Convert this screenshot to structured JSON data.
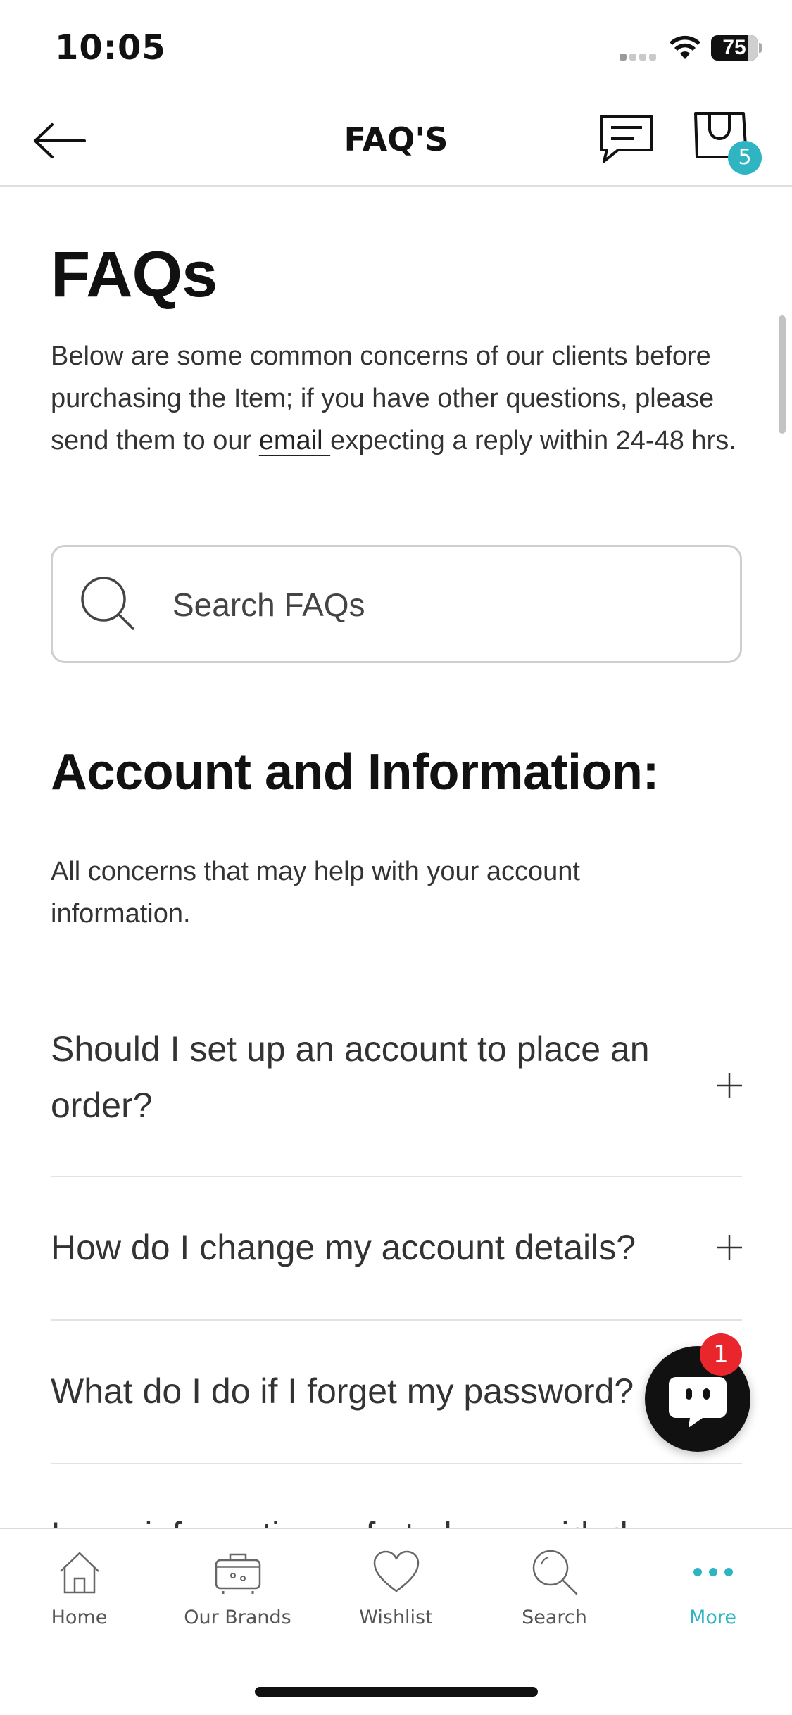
{
  "status_bar": {
    "time": "10:05",
    "battery": "75"
  },
  "nav": {
    "title": "FAQ'S",
    "cart_count": "5"
  },
  "page": {
    "title": "FAQs",
    "intro_before_link": "Below are some common concerns of our clients before purchasing the Item; if you have other questions, please send them to our ",
    "intro_link": "email ",
    "intro_after_link": "expecting a reply within 24-48 hrs."
  },
  "search": {
    "placeholder": "Search FAQs"
  },
  "section": {
    "title": "Account and Information:",
    "description": "All concerns that may help with your account information."
  },
  "faqs": [
    {
      "question": "Should I set up an account to place an order?"
    },
    {
      "question": "How do I change my account details?"
    },
    {
      "question": "What do I do if I forget my password?"
    },
    {
      "question": "Is my information safe to be provided"
    }
  ],
  "chat_widget": {
    "unread": "1"
  },
  "tabs": [
    {
      "label": "Home",
      "icon": "home-icon"
    },
    {
      "label": "Our Brands",
      "icon": "brands-icon"
    },
    {
      "label": "Wishlist",
      "icon": "heart-icon"
    },
    {
      "label": "Search",
      "icon": "search-icon"
    },
    {
      "label": "More",
      "icon": "more-icon"
    }
  ],
  "colors": {
    "accent": "#2fb5c1",
    "badge_red": "#e8262b",
    "text": "#333333"
  }
}
